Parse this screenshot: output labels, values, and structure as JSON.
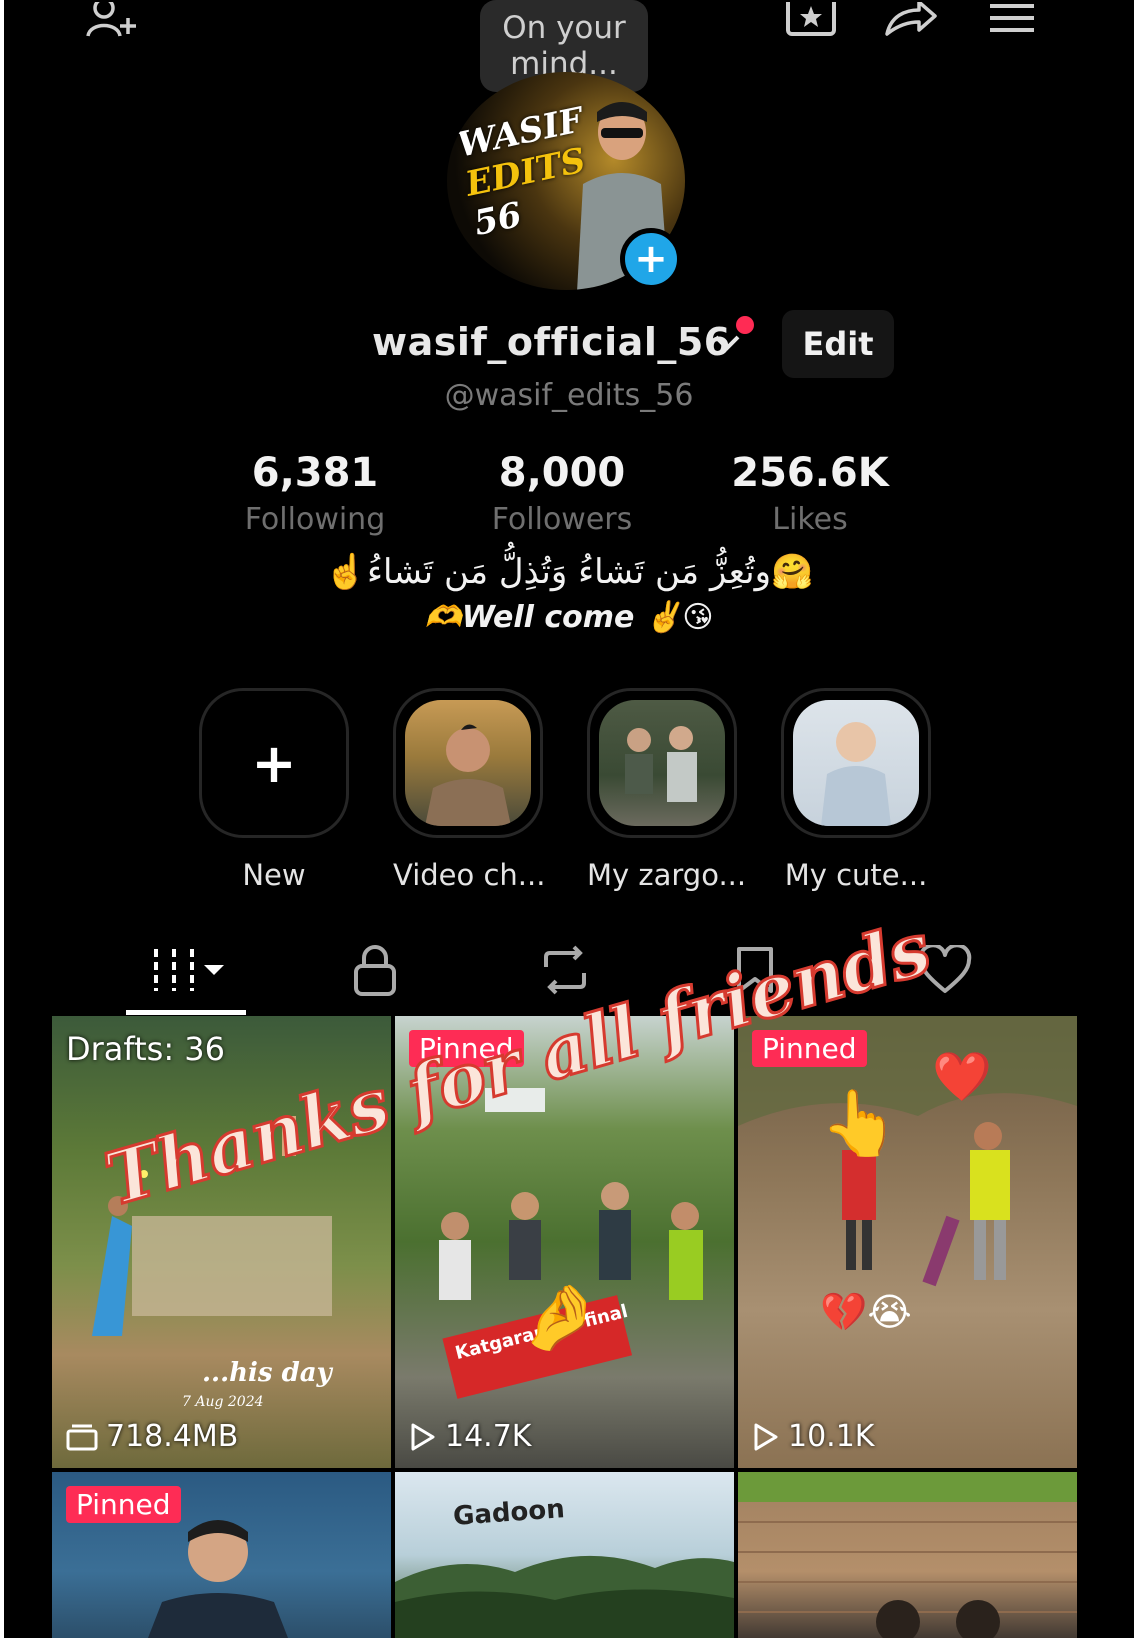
{
  "top": {
    "mind_bubble": "On your mind...",
    "icons": [
      "add-friend-icon",
      "star-box-icon",
      "share-icon",
      "menu-icon"
    ]
  },
  "avatar": {
    "text_line1": "WASIF",
    "text_line2": "EDITS",
    "text_line3": "56"
  },
  "profile": {
    "username": "wasif_official_56",
    "handle": "@wasif_edits_56",
    "edit_label": "Edit"
  },
  "stats": {
    "following": {
      "value": "6,381",
      "label": "Following"
    },
    "followers": {
      "value": "8,000",
      "label": "Followers"
    },
    "likes": {
      "value": "256.6K",
      "label": "Likes"
    }
  },
  "bio": {
    "line1": "☝️وتُعِزُّ مَن تَشاءُ وَتُذِلُّ مَن تَشاءُ🤗",
    "line2": "🫶Well come ✌️😘"
  },
  "highlights": [
    {
      "label": "New"
    },
    {
      "label": "Video ch..."
    },
    {
      "label": "My zargo..."
    },
    {
      "label": "My cute..."
    }
  ],
  "tabs": [
    "videos-grid",
    "private",
    "reposts",
    "favorites",
    "liked"
  ],
  "grid": [
    {
      "badge": "Drafts: 36",
      "stat": "718.4MB",
      "caption": "...his day",
      "date": "7 Aug 2024"
    },
    {
      "badge": "Pinned",
      "stat": "14.7K",
      "caption": "Katgaram ... final"
    },
    {
      "badge": "Pinned",
      "stat": "10.1K"
    },
    {
      "badge": "Pinned"
    },
    {
      "caption": "Gadoon"
    },
    {}
  ],
  "overlay": {
    "text": "Thanks for all friends"
  },
  "colors": {
    "background": "#000000",
    "pinned": "#fe2c55",
    "avatar_add": "#20a6e8",
    "notification_dot": "#ff2b54"
  }
}
